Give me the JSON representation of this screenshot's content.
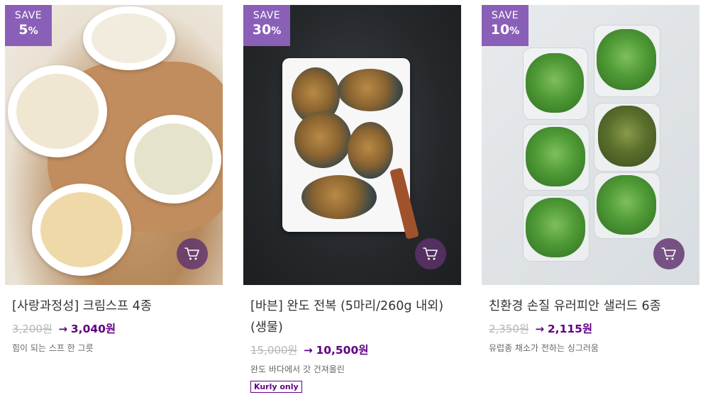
{
  "products": [
    {
      "badge_label": "SAVE",
      "badge_pct": "5",
      "badge_pct_sign": "%",
      "title": "[사랑과정성] 크림스프 4종",
      "original_price": "3,200원",
      "arrow": "→",
      "sale_price": "3,040원",
      "description": "힘이 되는 스프 한 그릇",
      "tag": "",
      "cart_icon": "cart-icon"
    },
    {
      "badge_label": "SAVE",
      "badge_pct": "30",
      "badge_pct_sign": "%",
      "title": "[바븐] 완도 전복 (5마리/260g 내외)(생물)",
      "original_price": "15,000원",
      "arrow": "→",
      "sale_price": "10,500원",
      "description": "완도 바다에서 갓 건져올린",
      "tag": "Kurly only",
      "cart_icon": "cart-icon"
    },
    {
      "badge_label": "SAVE",
      "badge_pct": "10",
      "badge_pct_sign": "%",
      "title": "친환경 손질 유러피안 샐러드 6종",
      "original_price": "2,350원",
      "arrow": "→",
      "sale_price": "2,115원",
      "description": "유럽종 채소가 전하는 싱그러움",
      "tag": "",
      "cart_icon": "cart-icon"
    }
  ],
  "colors": {
    "badge": "#8a5fb8",
    "price_accent": "#5f0080",
    "strike": "#b5b5b5"
  }
}
